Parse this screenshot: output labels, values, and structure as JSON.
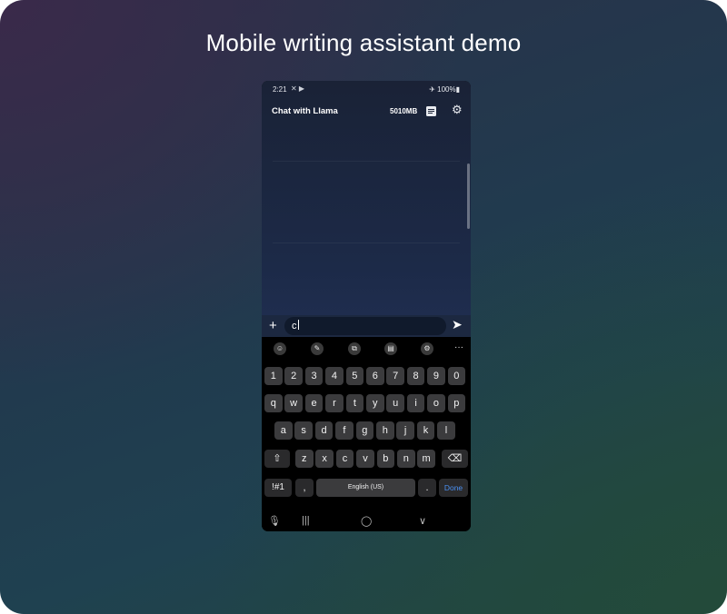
{
  "page": {
    "headline": "Mobile writing assistant demo"
  },
  "status_bar": {
    "time": "2:21",
    "status_icons": "✕ ▶",
    "right": "✈ 100%▮"
  },
  "app_bar": {
    "title": "Chat with Llama",
    "memory": "5010MB"
  },
  "composer": {
    "input_value": "c",
    "plus": "+",
    "send": "➤"
  },
  "keyboard": {
    "toolbar_icons": [
      "emoji-icon",
      "sticker-icon",
      "translate-icon",
      "clipboard-icon",
      "settings-icon",
      "more-icon"
    ],
    "toolbar_glyphs": [
      "☺",
      "✎",
      "⧉",
      "▤",
      "⚙",
      "···"
    ],
    "row_numbers": [
      "1",
      "2",
      "3",
      "4",
      "5",
      "6",
      "7",
      "8",
      "9",
      "0"
    ],
    "row_top": [
      "q",
      "w",
      "e",
      "r",
      "t",
      "y",
      "u",
      "i",
      "o",
      "p"
    ],
    "row_middle": [
      "a",
      "s",
      "d",
      "f",
      "g",
      "h",
      "j",
      "k",
      "l"
    ],
    "row_bottom": [
      "z",
      "x",
      "c",
      "v",
      "b",
      "n",
      "m"
    ],
    "shift": "⇧",
    "backspace": "⌫",
    "symbols": "!#1",
    "comma": ",",
    "space": "English (US)",
    "period": ".",
    "done": "Done"
  },
  "nav_bar": {
    "mic": "🎙",
    "recents": "|||",
    "home": "◯",
    "back": "∨"
  },
  "colors": {
    "done_accent": "#4a8ff0",
    "keyboard_bg": "#000000",
    "key_bg": "#3b3b3d"
  }
}
